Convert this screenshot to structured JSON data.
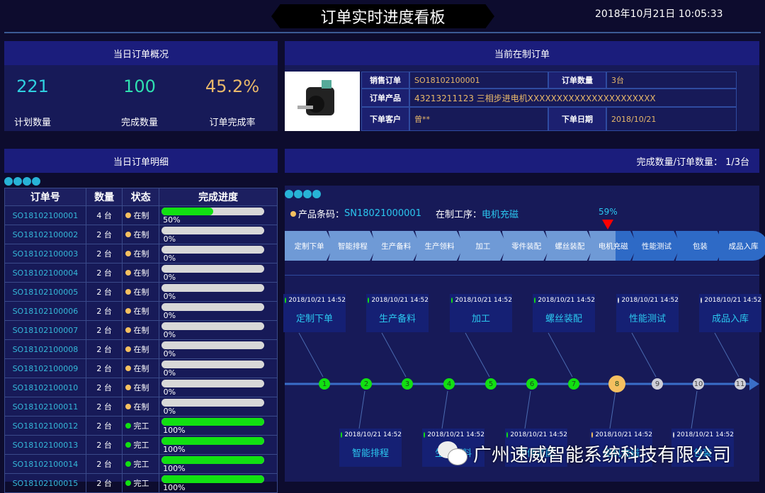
{
  "header": {
    "title": "订单实时进度看板",
    "datetime": "2018年10月21日  10:05:33"
  },
  "overview": {
    "title": "当日订单概况",
    "stats": [
      {
        "value": "221",
        "label": "计划数量",
        "color": "#2fd0e0"
      },
      {
        "value": "100",
        "label": "完成数量",
        "color": "#2fe0b0"
      },
      {
        "value": "45.2%",
        "label": "订单完成率",
        "color": "#e8b86a"
      }
    ]
  },
  "current": {
    "title": "当前在制订单",
    "image": "stepper-motor",
    "fields": {
      "sales_order_label": "销售订单",
      "sales_order": "SO18102100001",
      "qty_label": "订单数量",
      "qty": "3台",
      "product_label": "订单产品",
      "product": "43213211123 三相步进电机XXXXXXXXXXXXXXXXXXXXXX",
      "customer_label": "下单客户",
      "customer": "曾**",
      "date_label": "下单日期",
      "date": "2018/10/21"
    }
  },
  "detail": {
    "title": "当日订单明细",
    "columns": [
      "订单号",
      "数量",
      "状态",
      "完成进度"
    ],
    "rows": [
      {
        "id": "SO18102100001",
        "qty": "4 台",
        "status": "在制",
        "progress": 50,
        "pct": "50%"
      },
      {
        "id": "SO18102100002",
        "qty": "2 台",
        "status": "在制",
        "progress": 0,
        "pct": "0%"
      },
      {
        "id": "SO18102100003",
        "qty": "2 台",
        "status": "在制",
        "progress": 0,
        "pct": "0%"
      },
      {
        "id": "SO18102100004",
        "qty": "2 台",
        "status": "在制",
        "progress": 0,
        "pct": "0%"
      },
      {
        "id": "SO18102100005",
        "qty": "2 台",
        "status": "在制",
        "progress": 0,
        "pct": "0%"
      },
      {
        "id": "SO18102100006",
        "qty": "2 台",
        "status": "在制",
        "progress": 0,
        "pct": "0%"
      },
      {
        "id": "SO18102100007",
        "qty": "2 台",
        "status": "在制",
        "progress": 0,
        "pct": "0%"
      },
      {
        "id": "SO18102100008",
        "qty": "2 台",
        "status": "在制",
        "progress": 0,
        "pct": "0%"
      },
      {
        "id": "SO18102100009",
        "qty": "2 台",
        "status": "在制",
        "progress": 0,
        "pct": "0%"
      },
      {
        "id": "SO18102100010",
        "qty": "2 台",
        "status": "在制",
        "progress": 0,
        "pct": "0%"
      },
      {
        "id": "SO18102100011",
        "qty": "2 台",
        "status": "在制",
        "progress": 0,
        "pct": "0%"
      },
      {
        "id": "SO18102100012",
        "qty": "2 台",
        "status": "完工",
        "progress": 100,
        "pct": "100%"
      },
      {
        "id": "SO18102100013",
        "qty": "2 台",
        "status": "完工",
        "progress": 100,
        "pct": "100%"
      },
      {
        "id": "SO18102100014",
        "qty": "2 台",
        "status": "完工",
        "progress": 100,
        "pct": "100%"
      },
      {
        "id": "SO18102100015",
        "qty": "2 台",
        "status": "完工",
        "progress": 100,
        "pct": "100%"
      }
    ]
  },
  "process": {
    "ratio_label": "完成数量/订单数量：",
    "ratio": "1/3台",
    "barcode_label": "产品条码：",
    "barcode": "SN18021000001",
    "current_step_label": "在制工序：",
    "current_step": "电机充磁",
    "current_progress": "59%",
    "steps": [
      {
        "name": "定制下单",
        "time": "2018/10/21 14:52",
        "state": "done"
      },
      {
        "name": "智能排程",
        "time": "2018/10/21 14:52",
        "state": "done"
      },
      {
        "name": "生产备料",
        "time": "2018/10/21 14:52",
        "state": "done"
      },
      {
        "name": "生产领料",
        "time": "2018/10/21 14:52",
        "state": "done"
      },
      {
        "name": "加工",
        "time": "2018/10/21 14:52",
        "state": "done"
      },
      {
        "name": "零件装配",
        "time": "2018/10/21 14:52",
        "state": "done"
      },
      {
        "name": "螺丝装配",
        "time": "2018/10/21 14:52",
        "state": "done"
      },
      {
        "name": "电机充磁",
        "time": "2018/10/21 14:52",
        "state": "current"
      },
      {
        "name": "性能测试",
        "time": "2018/10/21 14:52",
        "state": "pending"
      },
      {
        "name": "包装",
        "time": "2018/10/21 14:52",
        "state": "pending"
      },
      {
        "name": "成品入库",
        "time": "2018/10/21 14:52",
        "state": "pending"
      }
    ]
  },
  "colors": {
    "done": "#12e012",
    "current": "#f5c060",
    "pending": "#cfcfd8",
    "cyan": "#2bc7ef"
  },
  "watermark": "广州速威智能系统科技有限公司"
}
